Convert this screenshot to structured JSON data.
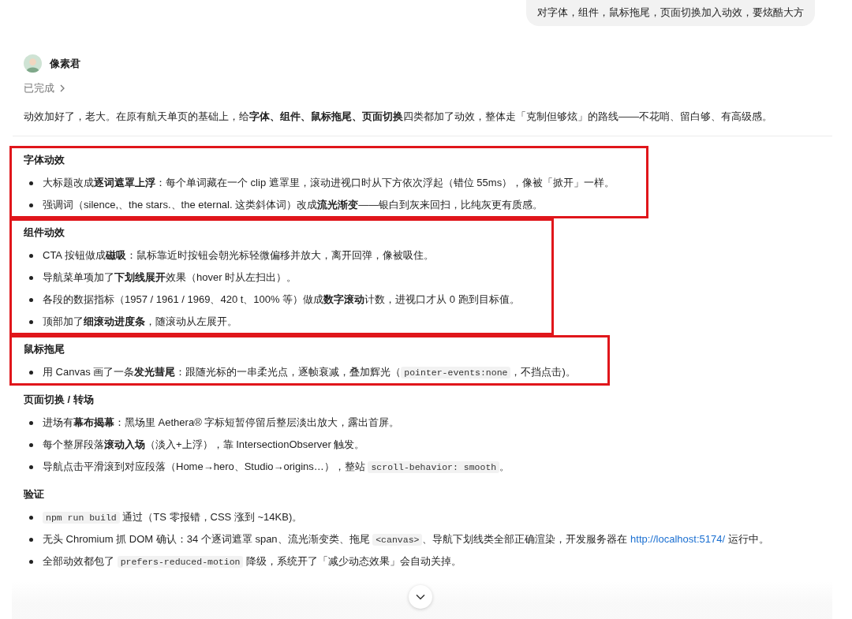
{
  "user_message": "对字体，组件，鼠标拖尾，页面切换加入动效，要炫酷大方",
  "assistant": {
    "name": "像素君",
    "status": "已完成",
    "intro": "动效加好了，老大。在原有航天单页的基础上，给**字体、组件、鼠标拖尾、页面切换**四类都加了动效，整体走「克制但够炫」的路线——不花哨、留白够、有高级感。"
  },
  "sections": [
    {
      "title": "字体动效",
      "highlighted": true,
      "items": [
        [
          {
            "kind": "text",
            "text": "大标题改成**逐词遮罩上浮**：每个单词藏在一个 clip 遮罩里，滚动进视口时从下方依次浮起（错位 55ms），像被「掀开」一样。"
          }
        ],
        [
          {
            "kind": "text",
            "text": "强调词（silence,、the stars.、the eternal. 这类斜体词）改成**流光渐变**——银白到灰来回扫，比纯灰更有质感。"
          }
        ]
      ]
    },
    {
      "title": "组件动效",
      "highlighted": true,
      "items": [
        [
          {
            "kind": "text",
            "text": "CTA 按钮做成**磁吸**：鼠标靠近时按钮会朝光标轻微偏移并放大，离开回弹，像被吸住。"
          }
        ],
        [
          {
            "kind": "text",
            "text": "导航菜单项加了**下划线展开**效果（hover 时从左扫出）。"
          }
        ],
        [
          {
            "kind": "text",
            "text": "各段的数据指标（1957 / 1961 / 1969、420 t、100% 等）做成**数字滚动**计数，进视口才从 0 跑到目标值。"
          }
        ],
        [
          {
            "kind": "text",
            "text": "顶部加了**细滚动进度条**，随滚动从左展开。"
          }
        ]
      ]
    },
    {
      "title": "鼠标拖尾",
      "highlighted": true,
      "items": [
        [
          {
            "kind": "text",
            "text": "用 Canvas 画了一条**发光彗尾**：跟随光标的一串柔光点，逐帧衰减，叠加辉光（"
          },
          {
            "kind": "code",
            "text": "pointer-events:none"
          },
          {
            "kind": "text",
            "text": "，不挡点击)。"
          }
        ]
      ]
    },
    {
      "title": "页面切换 / 转场",
      "highlighted": false,
      "items": [
        [
          {
            "kind": "text",
            "text": "进场有**幕布揭幕**：黑场里 Aethera® 字标短暂停留后整层淡出放大，露出首屏。"
          }
        ],
        [
          {
            "kind": "text",
            "text": "每个整屏段落**滚动入场**（淡入+上浮），靠 IntersectionObserver 触发。"
          }
        ],
        [
          {
            "kind": "text",
            "text": "导航点击平滑滚到对应段落（Home→hero、Studio→origins…），整站 "
          },
          {
            "kind": "code",
            "text": "scroll-behavior: smooth"
          },
          {
            "kind": "text",
            "text": "。"
          }
        ]
      ]
    },
    {
      "title": "验证",
      "highlighted": false,
      "items": [
        [
          {
            "kind": "code",
            "text": "npm run build"
          },
          {
            "kind": "text",
            "text": " 通过（TS 零报错，CSS 涨到 ~14KB)。"
          }
        ],
        [
          {
            "kind": "text",
            "text": "无头 Chromium 抓 DOM 确认：34 个逐词遮罩 span、流光渐变类、拖尾 "
          },
          {
            "kind": "code",
            "text": "<canvas>"
          },
          {
            "kind": "text",
            "text": "、导航下划线类全部正确渲染，开发服务器在 "
          },
          {
            "kind": "link",
            "text": "http://localhost:5174/"
          },
          {
            "kind": "text",
            "text": " 运行中。"
          }
        ],
        [
          {
            "kind": "text",
            "text": "全部动效都包了 "
          },
          {
            "kind": "code",
            "text": "prefers-reduced-motion"
          },
          {
            "kind": "text",
            "text": " 降级，系统开了「减少动态效果」会自动关掉。"
          }
        ]
      ]
    }
  ]
}
